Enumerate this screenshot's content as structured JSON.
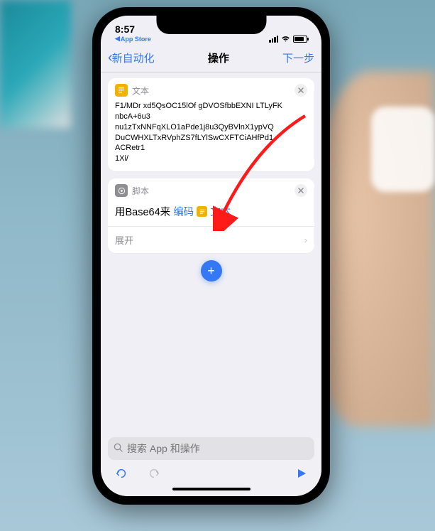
{
  "status": {
    "time": "8:57",
    "breadcrumb": "App Store"
  },
  "nav": {
    "back_label": "新自动化",
    "title": "操作",
    "next_label": "下一步"
  },
  "cards": {
    "text_card": {
      "header": "文本",
      "body_line1": "F1/MDr xd5QsOC15lOf gDVOSfbbEXNI LTLyFK",
      "body_line2": "nbcA+6u3",
      "body_line3": "nu1zTxNNFqXLO1aPde1j8u3QyBVlnX1ypVQ",
      "body_line4": "DuCWHXLTxRVphZS7fLYlSwCXFTCiAHfPd1",
      "body_line5": "ACRetr1",
      "body_line6": "1Xi/"
    },
    "script_card": {
      "header": "脚本",
      "prefix": "用Base64来",
      "encode_token": "编码",
      "text_token": "文本",
      "expand_label": "展开"
    }
  },
  "search": {
    "placeholder": "搜索 App 和操作"
  }
}
